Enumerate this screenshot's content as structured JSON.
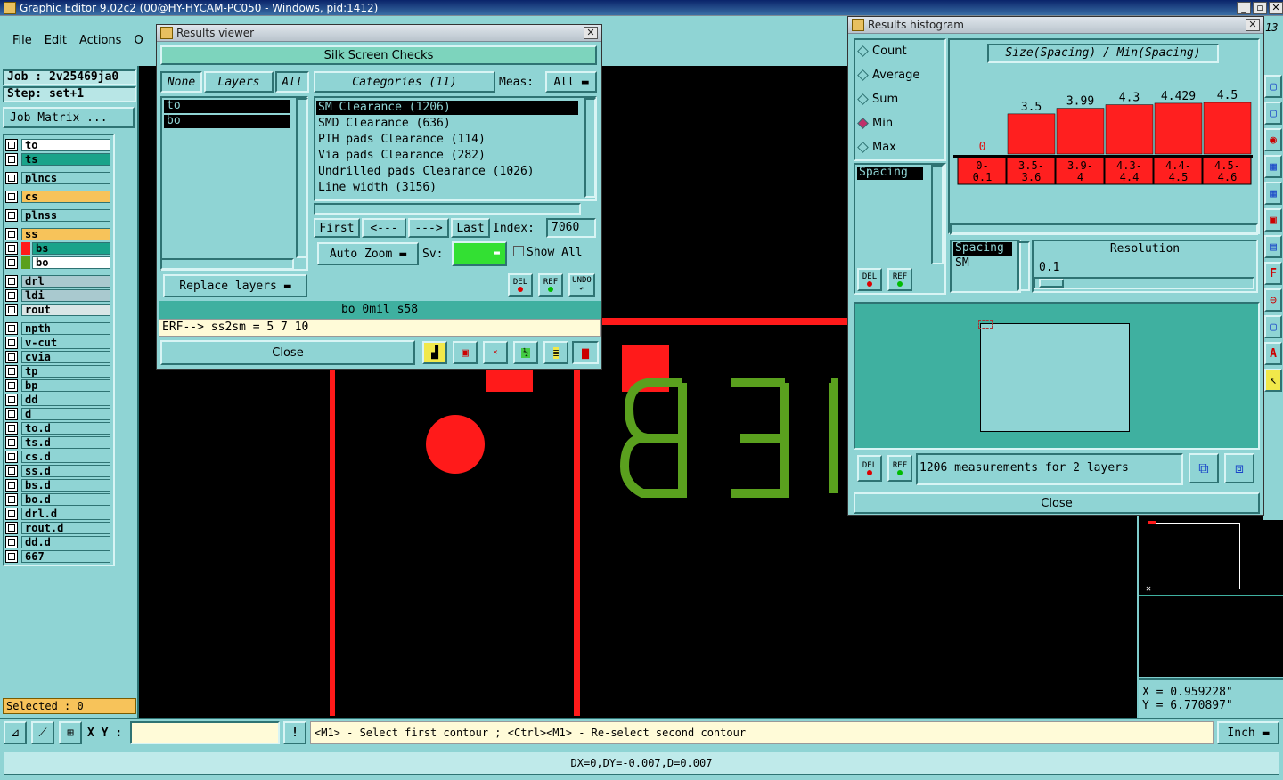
{
  "app": {
    "title": "Graphic Editor 9.02c2 (00@HY-HYCAM-PC050 - Windows, pid:1412)",
    "menu": [
      "File",
      "Edit",
      "Actions",
      "O"
    ],
    "version_right": "13"
  },
  "job": {
    "job_label": "Job : 2v25469ja0",
    "step_label": "Step: set+1",
    "matrix_button": "Job Matrix ..."
  },
  "layers": [
    {
      "name": "to",
      "color": "#ffffff"
    },
    {
      "name": "ts",
      "color": "#1aa38a"
    },
    {
      "name": "plncs",
      "color": "#8fd4d4"
    },
    {
      "name": "cs",
      "color": "#f7c35a"
    },
    {
      "name": "plnss",
      "color": "#8fd4d4"
    },
    {
      "name": "ss",
      "color": "#f7c35a"
    },
    {
      "name": "bs",
      "color": "#1aa38a"
    },
    {
      "name": "bo",
      "color": "#ffffff"
    },
    {
      "name": "drl",
      "color": "#a9c9cf"
    },
    {
      "name": "ldi",
      "color": "#a9c9cf"
    },
    {
      "name": "rout",
      "color": "#d9e6e6"
    },
    {
      "name": "npth",
      "color": "#8fd4d4"
    },
    {
      "name": "v-cut",
      "color": "#8fd4d4"
    },
    {
      "name": "cvia",
      "color": "#8fd4d4"
    },
    {
      "name": "tp",
      "color": "#8fd4d4"
    },
    {
      "name": "bp",
      "color": "#8fd4d4"
    },
    {
      "name": "dd",
      "color": "#8fd4d4"
    },
    {
      "name": "d",
      "color": "#8fd4d4"
    },
    {
      "name": "to.d",
      "color": "#8fd4d4"
    },
    {
      "name": "ts.d",
      "color": "#8fd4d4"
    },
    {
      "name": "cs.d",
      "color": "#8fd4d4"
    },
    {
      "name": "ss.d",
      "color": "#8fd4d4"
    },
    {
      "name": "bs.d",
      "color": "#8fd4d4"
    },
    {
      "name": "bo.d",
      "color": "#8fd4d4"
    },
    {
      "name": "drl.d",
      "color": "#8fd4d4"
    },
    {
      "name": "rout.d",
      "color": "#8fd4d4"
    },
    {
      "name": "dd.d",
      "color": "#8fd4d4"
    },
    {
      "name": "667",
      "color": "#8fd4d4"
    }
  ],
  "selected_label": "Selected : 0",
  "results_viewer": {
    "title": "Results viewer",
    "header": "Silk Screen Checks",
    "none_btn": "None",
    "layers_btn": "Layers",
    "all_btn": "All",
    "layer_items": [
      "to",
      "bo"
    ],
    "categories_btn": "Categories (11)",
    "meas_label": "Meas:",
    "meas_value": "All",
    "categories": [
      "SM Clearance (1206)",
      "SMD Clearance (636)",
      "PTH pads Clearance (114)",
      "Via pads Clearance (282)",
      "Undrilled pads Clearance (1026)",
      "Line width (3156)"
    ],
    "first_btn": "First",
    "prev_btn": "<---",
    "next_btn": "--->",
    "last_btn": "Last",
    "index_label": "Index:",
    "index_value": "7060",
    "auto_zoom": "Auto Zoom",
    "sv_label": "Sv:",
    "show_all": "Show All",
    "replace_layers": "Replace layers",
    "del_label": "DEL",
    "ref_label": "REF",
    "undo_label": "UNDO",
    "info_line": "bo  0mil  s58",
    "erf_line": "ERF--> ss2sm = 5 7 10",
    "close_btn": "Close"
  },
  "histogram": {
    "title": "Results histogram",
    "options": [
      "Count",
      "Average",
      "Sum",
      "Min",
      "Max"
    ],
    "selected_option": "Min",
    "chart_title": "Size(Spacing) / Min(Spacing)",
    "list_item": "Spacing",
    "sel_spacing": "Spacing",
    "sel_sm": "SM",
    "resolution_label": "Resolution",
    "resolution_value": "0.1",
    "del_label": "DEL",
    "ref_label": "REF",
    "measurements": "1206 measurements for 2 layers",
    "close_btn": "Close"
  },
  "chart_data": {
    "type": "bar",
    "title": "Size(Spacing) / Min(Spacing)",
    "categories": [
      "0-\n0.1",
      "3.5-\n3.6",
      "3.9-\n4",
      "4.3-\n4.4",
      "4.4-\n4.5",
      "4.5-\n4.6"
    ],
    "cat_lines": [
      [
        "0-",
        "0.1"
      ],
      [
        "3.5-",
        "3.6"
      ],
      [
        "3.9-",
        "4"
      ],
      [
        "4.3-",
        "4.4"
      ],
      [
        "4.4-",
        "4.5"
      ],
      [
        "4.5-",
        "4.6"
      ]
    ],
    "values": [
      0,
      3.5,
      3.99,
      4.3,
      4.429,
      4.5
    ],
    "data_labels": [
      "0",
      "3.5",
      "3.99",
      "4.3",
      "4.429",
      "4.5"
    ],
    "ylim": [
      0,
      4.5
    ],
    "bar_color": "#ff1f1f",
    "label_color_zero": "#e01010"
  },
  "coords": {
    "x": "X  =  0.959228\"",
    "y": "Y  =  6.770897\""
  },
  "bottom": {
    "xy_label": "X Y :",
    "hint": "<M1> - Select first contour ; <Ctrl><M1> - Re-select second contour",
    "unit": "Inch",
    "status": "DX=0,DY=-0.007,D=0.007"
  },
  "canvas_text": "BET",
  "colors": {
    "red": "#ff1a1a",
    "green": "#5aa01e",
    "teal": "#8fd4d4"
  }
}
